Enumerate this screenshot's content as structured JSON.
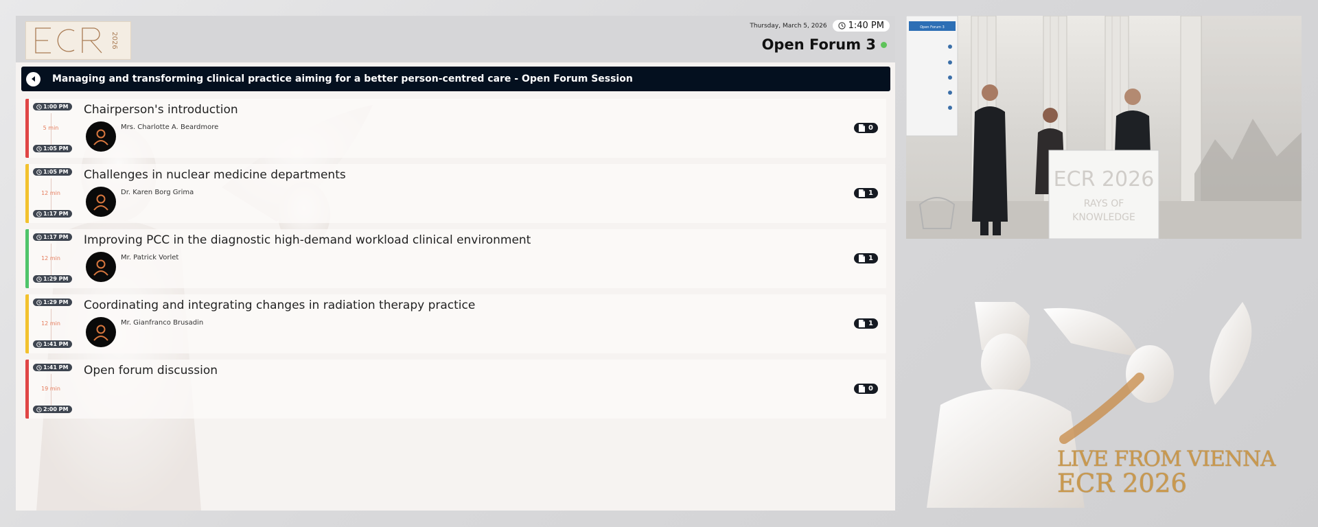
{
  "header": {
    "logo_text": "ECR 2026",
    "date": "Thursday, March 5, 2026",
    "time": "1:40 PM",
    "room": "Open Forum 3",
    "status_color": "#5ec35a"
  },
  "session": {
    "title": "Managing and transforming clinical practice aiming for a better person-centred care - Open Forum Session"
  },
  "agenda": [
    {
      "start": "1:00 PM",
      "end": "1:05 PM",
      "duration": "5 min",
      "title": "Chairperson's introduction",
      "speaker": "Mrs. Charlotte A. Beardmore",
      "docs": "0",
      "accent": "#e04545"
    },
    {
      "start": "1:05 PM",
      "end": "1:17 PM",
      "duration": "12 min",
      "title": "Challenges in nuclear medicine departments",
      "speaker": "Dr. Karen Borg Grima",
      "docs": "1",
      "accent": "#f2c12e"
    },
    {
      "start": "1:17 PM",
      "end": "1:29 PM",
      "duration": "12 min",
      "title": "Improving PCC in the diagnostic high-demand workload clinical environment",
      "speaker": "Mr. Patrick Vorlet",
      "docs": "1",
      "accent": "#4fc46a"
    },
    {
      "start": "1:29 PM",
      "end": "1:41 PM",
      "duration": "12 min",
      "title": "Coordinating and integrating changes in radiation therapy practice",
      "speaker": "Mr. Gianfranco Brusadin",
      "docs": "1",
      "accent": "#f2c12e"
    },
    {
      "start": "1:41 PM",
      "end": "2:00 PM",
      "duration": "19 min",
      "title": "Open forum discussion",
      "speaker": "",
      "docs": "0",
      "accent": "#e04545"
    }
  ],
  "video": {
    "podium_logo": "ECR 2026",
    "podium_tagline_1": "RAYS OF",
    "podium_tagline_2": "KNOWLEDGE",
    "screen_label": "Open Forum 3"
  },
  "banner": {
    "line1": "LIVE FROM VIENNA",
    "line2": "ECR 2026"
  },
  "icons": {
    "back": "chevron-left-icon",
    "clock": "clock-icon",
    "document": "document-icon",
    "avatar": "user-icon"
  }
}
